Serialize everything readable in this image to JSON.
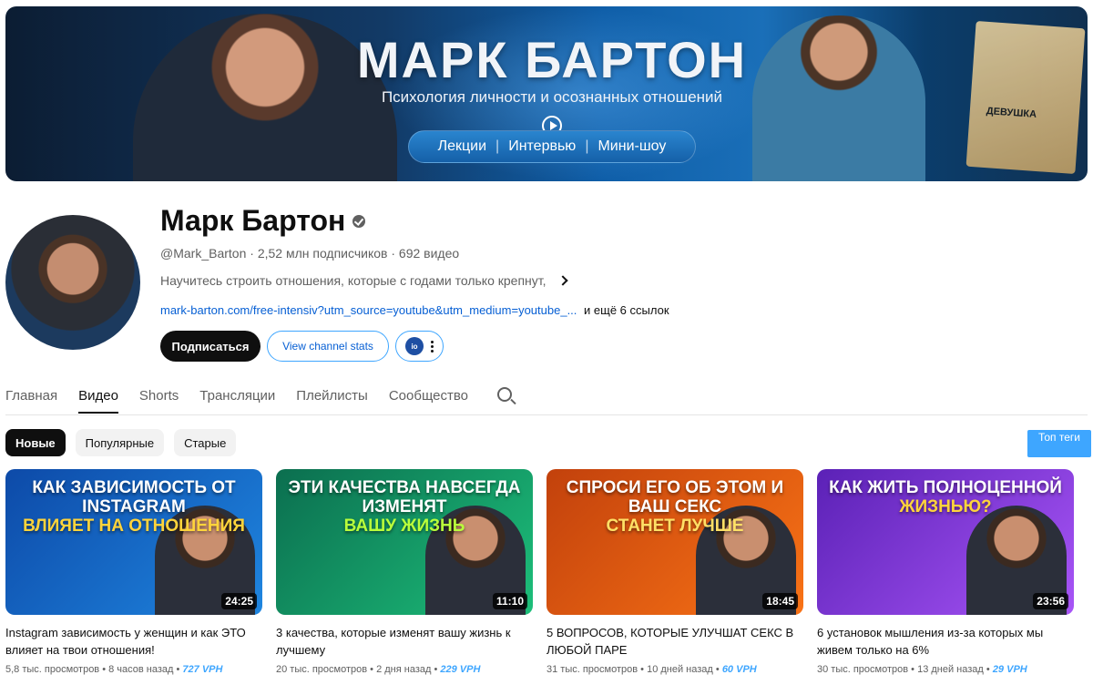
{
  "banner": {
    "title": "МАРК БАРТОН",
    "subtitle_part1": "Психология личности",
    "subtitle_part2": "и осознанных отношений",
    "pill_items": [
      "Лекции",
      "Интервью",
      "Мини-шоу"
    ],
    "book_text": "ДЕВУШКА"
  },
  "channel": {
    "name": "Марк Бартон",
    "handle": "@Mark_Barton",
    "subscribers": "2,52 млн подписчиков",
    "videos_count": "692 видео",
    "description": "Научитесь строить отношения, которые с годами только крепнут,",
    "link": "mark-barton.com/free-intensiv?utm_source=youtube&utm_medium=youtube_...",
    "more_links": "и ещё 6 ссылок",
    "subscribe_label": "Подписаться",
    "stats_label": "View channel stats",
    "ext_logo": "io"
  },
  "tabs": [
    {
      "label": "Главная"
    },
    {
      "label": "Видео"
    },
    {
      "label": "Shorts"
    },
    {
      "label": "Трансляции"
    },
    {
      "label": "Плейлисты"
    },
    {
      "label": "Сообщество"
    }
  ],
  "chips": [
    {
      "label": "Новые"
    },
    {
      "label": "Популярные"
    },
    {
      "label": "Старые"
    }
  ],
  "top_tags_label": "Топ теги",
  "videos": [
    {
      "thumb_line1": "КАК ЗАВИСИМОСТЬ ОТ INSTAGRAM",
      "thumb_line2": "ВЛИЯЕТ НА ОТНОШЕНИЯ",
      "duration": "24:25",
      "title": "Instagram зависимость у женщин и как ЭТО влияет на твои отношения!",
      "views": "5,8 тыс. просмотров",
      "age": "8 часов назад",
      "vph": "727 VPH",
      "colors": {
        "bg1": "#0d4aa8",
        "bg2": "#1f86e0",
        "accent": "#ffd43b"
      }
    },
    {
      "thumb_line1": "ЭТИ КАЧЕСТВА НАВСЕГДА ИЗМЕНЯТ",
      "thumb_line2": "ВАШУ ЖИЗНЬ",
      "duration": "11:10",
      "title": "3 качества, которые изменят вашу жизнь к лучшему",
      "views": "20 тыс. просмотров",
      "age": "2 дня назад",
      "vph": "229 VPH",
      "colors": {
        "bg1": "#0b6e4f",
        "bg2": "#1dbf7a",
        "accent": "#b9ff3b"
      }
    },
    {
      "thumb_line1": "СПРОСИ ЕГО ОБ ЭТОМ И ВАШ СЕКС",
      "thumb_line2": "СТАНЕТ ЛУЧШЕ",
      "duration": "18:45",
      "title": "5 ВОПРОСОВ, КОТОРЫЕ УЛУЧШАТ СЕКС В ЛЮБОЙ ПАРЕ",
      "views": "31 тыс. просмотров",
      "age": "10 дней назад",
      "vph": "60 VPH",
      "colors": {
        "bg1": "#c2410c",
        "bg2": "#f97316",
        "accent": "#ffe066"
      }
    },
    {
      "thumb_line1": "КАК ЖИТЬ ПОЛНОЦЕННОЙ",
      "thumb_line2": "ЖИЗНЬЮ?",
      "duration": "23:56",
      "title": "6 установок мышления из-за которых мы живем только на 6%",
      "views": "30 тыс. просмотров",
      "age": "13 дней назад",
      "vph": "29 VPH",
      "colors": {
        "bg1": "#5b21b6",
        "bg2": "#a855f7",
        "accent": "#ffd43b"
      }
    }
  ]
}
